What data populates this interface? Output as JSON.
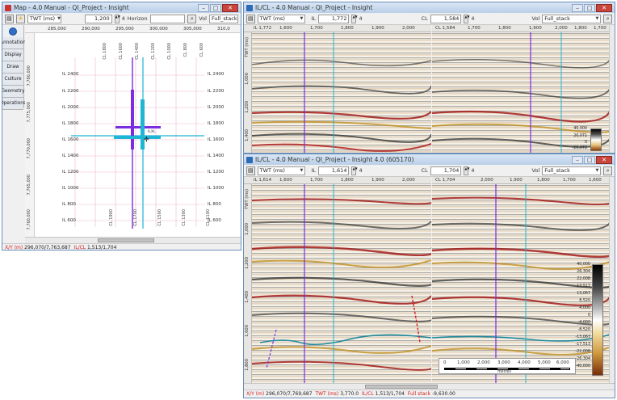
{
  "map_window": {
    "title": "Map - 4.0 Manual - QI_Project - Insight",
    "domain_select": "TWT (ms)",
    "inline_value": "1,200",
    "step_value": "4",
    "horizon_label": "Horizon",
    "vol_label": "Vol",
    "vol_value": "Full_stack",
    "sidebar_tabs": [
      "Annotation",
      "Display",
      "Draw",
      "Culture",
      "Geometry",
      "Operations"
    ],
    "top_x_labels": [
      "285,000",
      "290,000",
      "295,000",
      "300,000",
      "305,000",
      "310,0"
    ],
    "left_y_labels": [
      "7,780,000",
      "7,775,000",
      "7,770,000",
      "7,765,000",
      "7,760,000"
    ],
    "il_labels": [
      "IL 2400",
      "IL 2200",
      "IL 2000",
      "IL 1800",
      "IL 1600",
      "IL 1400",
      "IL 1200",
      "IL 1000",
      "IL 800",
      "IL 600"
    ],
    "cl_labels": [
      "CL 1800",
      "CL 1600",
      "CL 1400",
      "CL 1200",
      "CL 1000",
      "CL 800",
      "CL 600"
    ],
    "cl_bottom_labels": [
      "CL 1900",
      "CL 1700",
      "CL 1500",
      "CL 1300",
      "CL 1100"
    ],
    "cursor_label": "ILXL",
    "status": {
      "k1": "X/Y (m)",
      "v1": "296,070/7,763,687",
      "k2": "IL/CL",
      "v2": "1,513/1,704"
    }
  },
  "top_section": {
    "title": "IL/CL - 4.0 Manual - QI_Project - Insight",
    "domain_select": "TWT (ms)",
    "il_label": "IL",
    "il_value": "1,772",
    "cl_label": "CL",
    "cl_value": "1,584",
    "step": "4",
    "vol_label": "Vol",
    "vol_value": "Full_stack",
    "left_header": "IL 1,772",
    "right_header": "CL 1,584",
    "left_ticks": [
      "1,600",
      "1,700",
      "1,800",
      "1,900",
      "2,000"
    ],
    "right_ticks": [
      "1,700",
      "1,800",
      "1,900",
      "2,000",
      "1,800",
      "1,700"
    ],
    "vaxis": [
      "TWT (ms)",
      "1,000",
      "1,200",
      "1,400"
    ],
    "colorbar": [
      "40,000",
      "20,071",
      "0",
      "-20,072"
    ]
  },
  "bottom_section": {
    "title": "IL/CL - 4.0 Manual - QI_Project - Insight 4.0 (605170)",
    "domain_select": "TWT (ms)",
    "il_label": "IL",
    "il_value": "1,614",
    "cl_label": "CL",
    "cl_value": "1,704",
    "step": "4",
    "vol_label": "Vol",
    "vol_value": "Full_stack",
    "left_header": "IL 1,614",
    "right_header": "CL 1,704",
    "left_ticks": [
      "1,600",
      "1,700",
      "1,800",
      "1,900",
      "2,000"
    ],
    "right_ticks": [
      "2,000",
      "1,900",
      "1,800",
      "1,700",
      "1,600"
    ],
    "vaxis": [
      "TWT (ms)",
      "1,000",
      "1,200",
      "1,400",
      "1,600",
      "1,800"
    ],
    "colorbar": [
      "40,000",
      "26,304",
      "22,008",
      "17,513",
      "13,067",
      "8,520",
      "4,000",
      "0",
      "-4,000",
      "-8,520",
      "-13,067",
      "-17,513",
      "-22,008",
      "-26,304",
      "-40,000"
    ],
    "scale_ticks": [
      "0",
      "1,000",
      "2,000",
      "3,000",
      "4,000",
      "5,000",
      "6,000"
    ],
    "scale_unit": "metres",
    "status": {
      "k1": "X/Y (m)",
      "v1": "296,070/7,769,687",
      "k2": "TWT (ms)",
      "v2": "3,770.0",
      "k3": "IL/CL",
      "v3": "1,513/1,704",
      "k4": "Full stack",
      "v4": "-9,630.00"
    }
  },
  "colors": {
    "inline": "#7b2be0",
    "crossline": "#1fb5d4",
    "accent": "#d31b1b"
  }
}
